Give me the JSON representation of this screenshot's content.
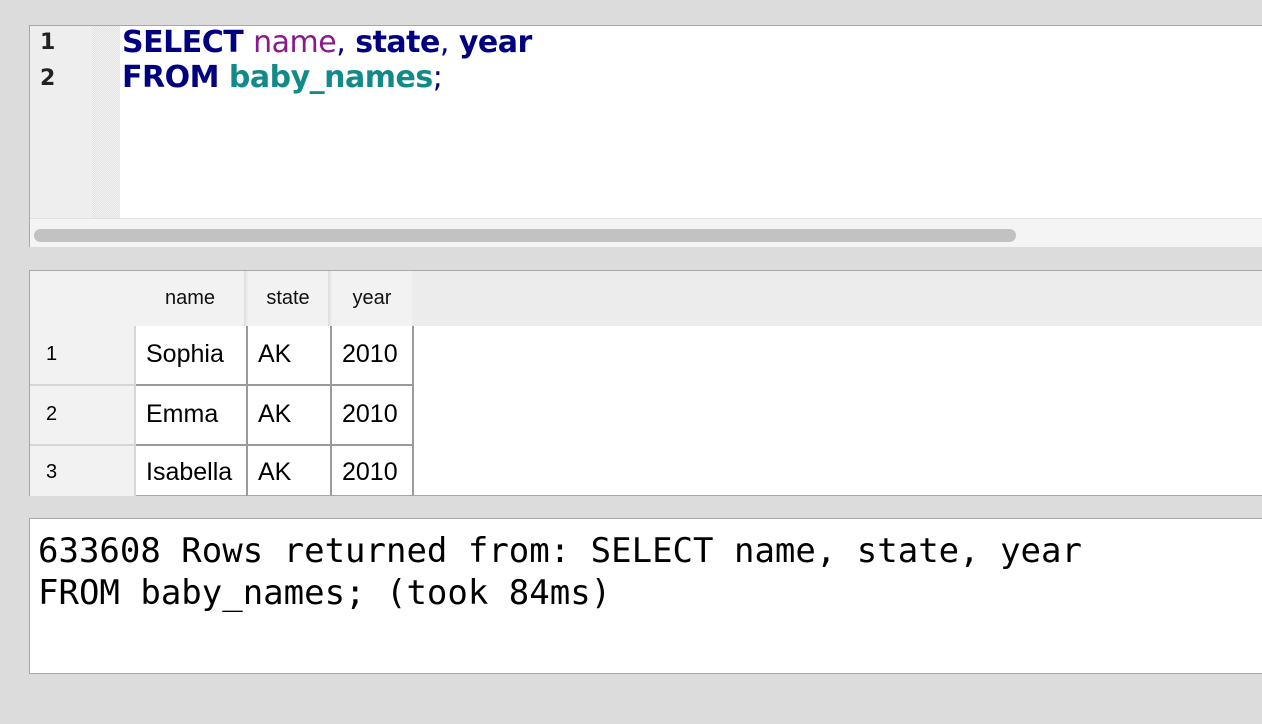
{
  "editor": {
    "line_numbers": [
      "1",
      "2"
    ],
    "line1": {
      "keyword": "SELECT",
      "col1": "name",
      "sep1": ",",
      "col2": "state",
      "sep2": ",",
      "col3": "year"
    },
    "line2": {
      "keyword": "FROM",
      "table": "baby_names",
      "terminator": ";"
    }
  },
  "results": {
    "columns": [
      "name",
      "state",
      "year"
    ],
    "rows": [
      {
        "num": "1",
        "name": "Sophia",
        "state": "AK",
        "year": "2010"
      },
      {
        "num": "2",
        "name": "Emma",
        "state": "AK",
        "year": "2010"
      },
      {
        "num": "3",
        "name": "Isabella",
        "state": "AK",
        "year": "2010"
      }
    ]
  },
  "message": {
    "line1": "633608 Rows returned from: SELECT name, state, year",
    "line2": "FROM baby_names; (took 84ms)"
  },
  "colors": {
    "keyword": "#000080",
    "column_name": "#8a1a8a",
    "table_name": "#138a8a",
    "background": "#dcdcdc"
  }
}
